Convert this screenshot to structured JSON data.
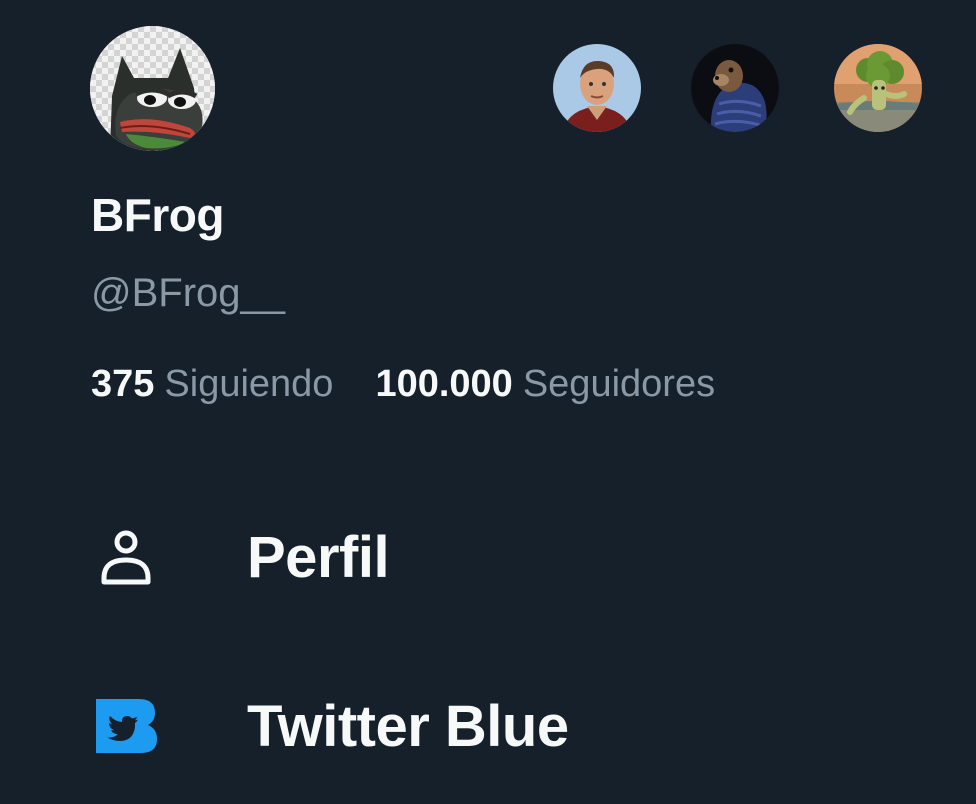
{
  "profile": {
    "display_name": "BFrog",
    "handle": "@BFrog__",
    "avatar_icon": "frog-avatar"
  },
  "other_accounts": [
    {
      "avatar_icon": "man-portrait-avatar"
    },
    {
      "avatar_icon": "otter-in-jacket-avatar"
    },
    {
      "avatar_icon": "broccoli-avatar"
    }
  ],
  "stats": {
    "following_count": "375",
    "following_label": "Siguiendo",
    "followers_count": "100.000",
    "followers_label": "Seguidores"
  },
  "menu": {
    "profile_label": "Perfil",
    "profile_icon": "person-icon",
    "twitter_blue_label": "Twitter Blue",
    "twitter_blue_icon": "twitter-blue-icon"
  },
  "colors": {
    "background": "#15202b",
    "primary_text": "#f7f9f9",
    "secondary_text": "#8b98a5",
    "twitter_blue": "#1d9bf0"
  }
}
